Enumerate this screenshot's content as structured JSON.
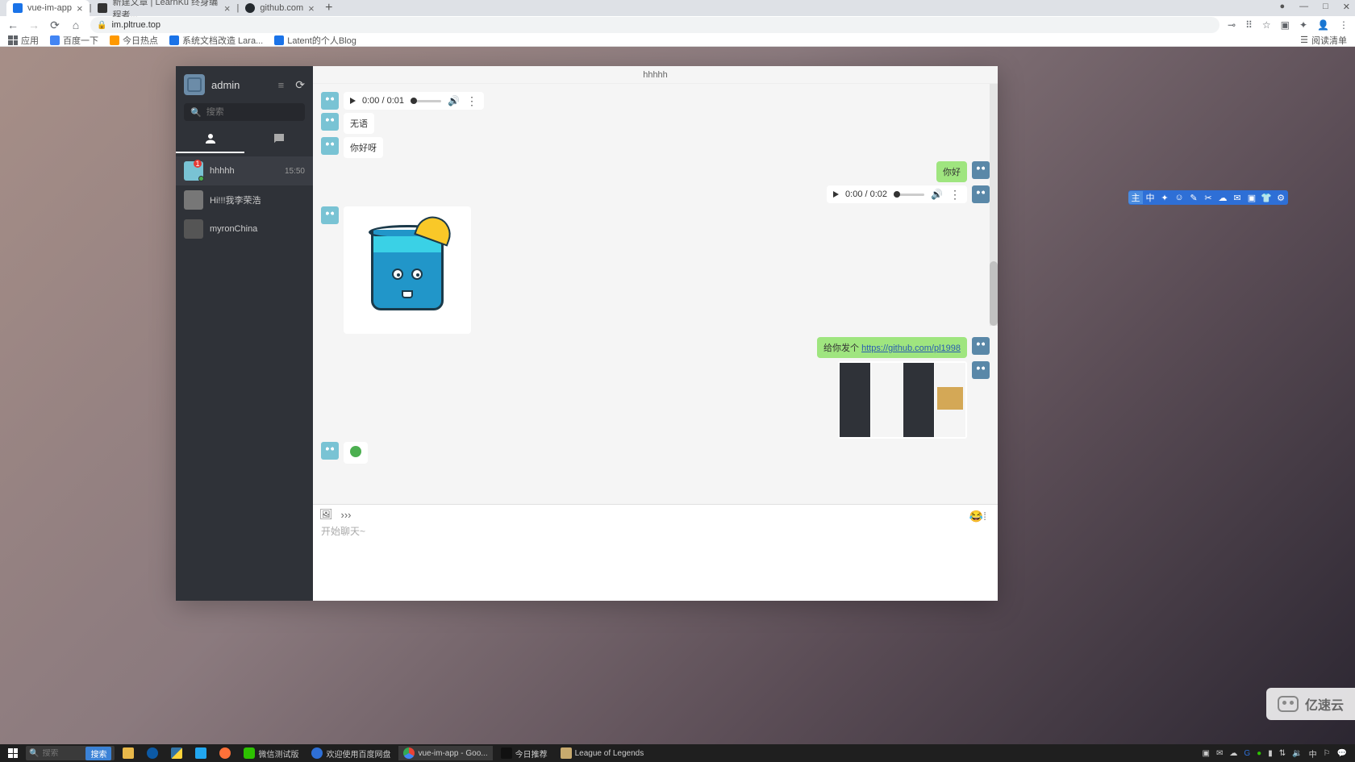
{
  "browser": {
    "tabs": [
      {
        "title": "vue-im-app",
        "active": true
      },
      {
        "title": "新建文章 | LearnKu 终身编程者..."
      },
      {
        "title": "github.com"
      }
    ],
    "url": "im.pltrue.top",
    "window_controls": {
      "rec": "●",
      "min": "—",
      "max": "□",
      "close": "✕"
    },
    "bookmarks": {
      "apps": "应用",
      "items": [
        "百度一下",
        "今日热点",
        "系统文档改造 Lara...",
        "Latent的个人Blog"
      ],
      "reader": "阅读清单"
    }
  },
  "app": {
    "username": "admin",
    "search_placeholder": "搜索",
    "chat_title": "hhhhh",
    "contacts": [
      {
        "name": "hhhhh",
        "time": "15:50",
        "badge": "1",
        "online": true
      },
      {
        "name": "Hi!!!我李荣浩"
      },
      {
        "name": "myronChina"
      }
    ],
    "messages": {
      "audio_in": "0:00 / 0:01",
      "text_in_1": "无语",
      "text_in_2": "你好呀",
      "text_out_1": "你好",
      "audio_out": "0:00 / 0:02",
      "link_prefix": "给你发个 ",
      "link_url": "https://github.com/pl1998"
    },
    "composer": {
      "placeholder": "开始聊天~"
    }
  },
  "float_toolbar": [
    "主",
    "中",
    "✦",
    "☺",
    "✎",
    "✂",
    "☁",
    "✉",
    "▣",
    "👕",
    "⚙"
  ],
  "watermark": "亿速云",
  "taskbar": {
    "search_placeholder": "搜索",
    "search_btn": "搜索",
    "items": [
      "微信测试版",
      "欢迎使用百度网盘",
      "vue-im-app - Goo...",
      "今日推荐",
      "League of Legends"
    ]
  }
}
